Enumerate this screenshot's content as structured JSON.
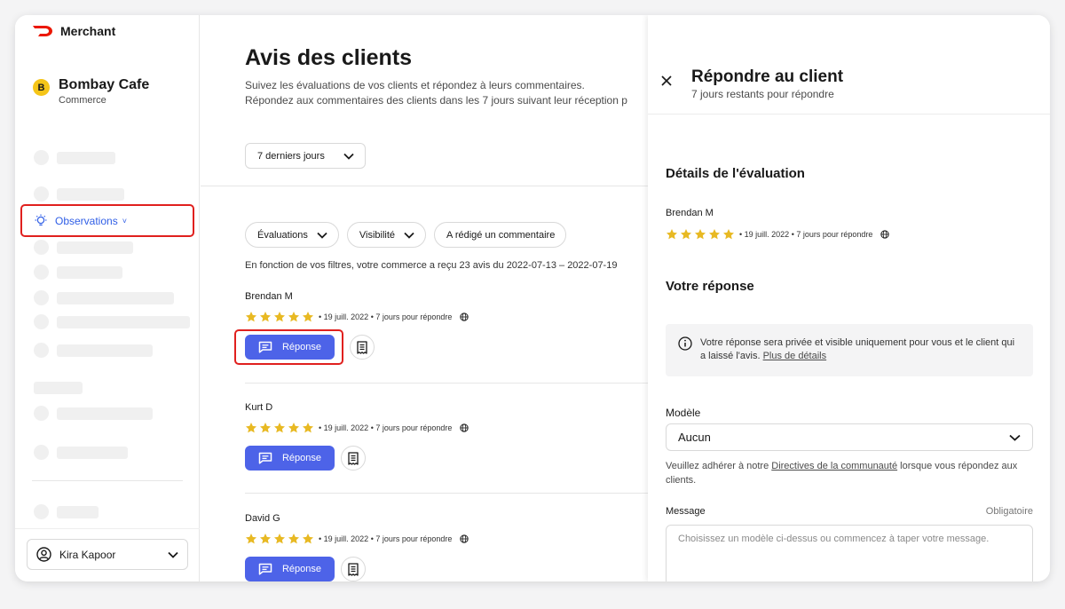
{
  "app": {
    "brand": "Merchant"
  },
  "store": {
    "initial": "B",
    "name": "Bombay Cafe",
    "type": "Commerce"
  },
  "nav": {
    "active_label": "Observations",
    "active_chevron": "˅"
  },
  "user": {
    "name": "Kira Kapoor"
  },
  "page": {
    "title": "Avis des clients",
    "desc_line1": "Suivez les évaluations de vos clients et répondez à leurs commentaires.",
    "desc_line2": "Répondez aux commentaires des clients dans les 7 jours suivant leur réception p"
  },
  "date_filter": {
    "value": "7 derniers jours"
  },
  "filters": {
    "ratings": "Évaluations",
    "visibility": "Visibilité",
    "commented": "A rédigé un commentaire"
  },
  "filter_info": "En fonction de vos filtres, votre commerce a reçu 23 avis du 2022-07-13 – 2022-07-19",
  "reviews": [
    {
      "name": "Brendan M",
      "rating": 5,
      "meta": "• 19 juill. 2022 • 7 jours pour répondre",
      "reply_label": "Réponse"
    },
    {
      "name": "Kurt D",
      "rating": 5,
      "meta": "• 19 juill. 2022 • 7 jours pour répondre",
      "reply_label": "Réponse"
    },
    {
      "name": "David G",
      "rating": 5,
      "meta": "• 19 juill. 2022 • 7 jours pour répondre",
      "reply_label": "Réponse"
    }
  ],
  "panel": {
    "title": "Répondre au client",
    "subtitle": "7 jours restants pour répondre",
    "details_title": "Détails de l'évaluation",
    "reviewer": "Brendan M",
    "rating": 5,
    "review_meta": "• 19 juill. 2022 • 7 jours pour répondre",
    "response_title": "Votre réponse",
    "info_text": "Votre réponse sera privée et visible uniquement pour vous et le client qui a laissé l'avis.",
    "info_link": "Plus de détails",
    "template_label": "Modèle",
    "template_value": "Aucun",
    "hint_prefix": "Veuillez adhérer à notre",
    "hint_link": "Directives de la communauté",
    "hint_suffix": "lorsque vous répondez aux clients.",
    "message_label": "Message",
    "message_required": "Obligatoire",
    "message_placeholder": "Choisissez un modèle ci-dessus ou commencez à taper votre message."
  },
  "colors": {
    "accent": "#4d63e8",
    "highlight": "#e0201e",
    "star": "#e8b923",
    "nav_active": "#2f5ee6",
    "brand_red": "#eb1700"
  },
  "icons": [
    "doordash-logo-icon",
    "lightbulb-icon",
    "chevron-down-icon",
    "user-circle-icon",
    "message-icon",
    "receipt-icon",
    "globe-icon",
    "star-icon",
    "close-icon",
    "info-icon"
  ]
}
